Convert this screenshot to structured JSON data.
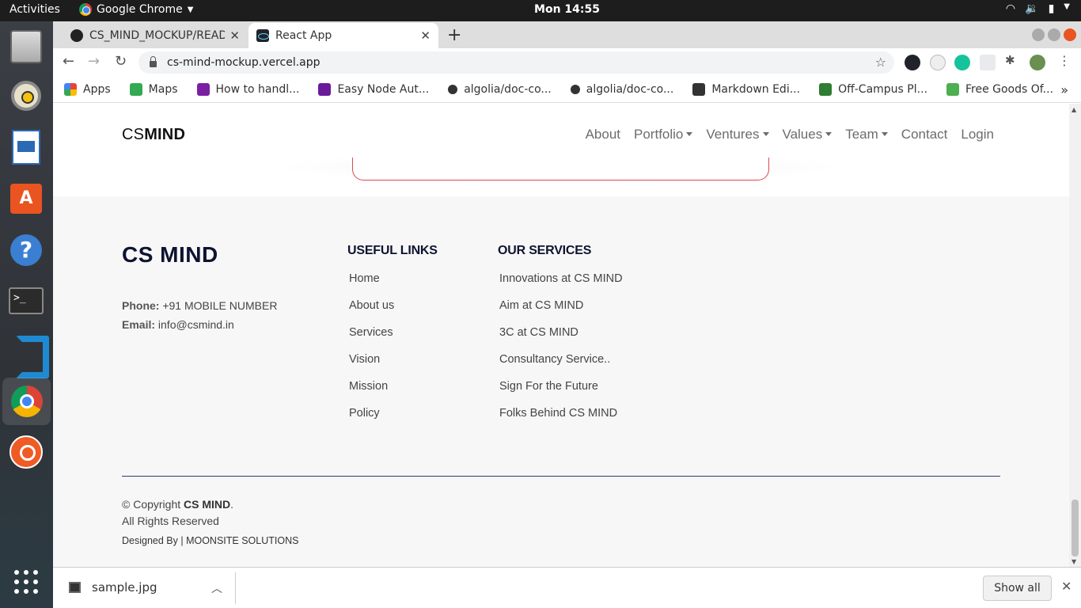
{
  "topbar": {
    "activities": "Activities",
    "app_name": "Google Chrome",
    "clock": "Mon 14:55"
  },
  "tabs": [
    {
      "title": "CS_MIND_MOCKUP/READ",
      "active": false
    },
    {
      "title": "React App",
      "active": true
    }
  ],
  "toolbar": {
    "url": "cs-mind-mockup.vercel.app"
  },
  "bookmarks": [
    {
      "label": "Apps",
      "icon": "apps-grid-icon",
      "color": "#4285f4"
    },
    {
      "label": "Maps",
      "icon": "maps-icon",
      "color": "#34a853"
    },
    {
      "label": "How to handl...",
      "icon": "bookmark-icon",
      "color": "#7b1fa2"
    },
    {
      "label": "Easy Node Aut...",
      "icon": "bookmark-icon",
      "color": "#6a1b9a"
    },
    {
      "label": "algolia/doc-co...",
      "icon": "github-icon",
      "color": "#333333"
    },
    {
      "label": "algolia/doc-co...",
      "icon": "github-icon",
      "color": "#333333"
    },
    {
      "label": "Markdown Edi...",
      "icon": "bookmark-icon",
      "color": "#333333"
    },
    {
      "label": "Off-Campus Pl...",
      "icon": "bookmark-icon",
      "color": "#2e7d32"
    },
    {
      "label": "Free Goods Of...",
      "icon": "tag-icon",
      "color": "#4caf50"
    }
  ],
  "site": {
    "brand_light": "CS",
    "brand_bold": "MIND",
    "nav": [
      {
        "label": "About",
        "dropdown": false
      },
      {
        "label": "Portfolio",
        "dropdown": true
      },
      {
        "label": "Ventures",
        "dropdown": true
      },
      {
        "label": "Values",
        "dropdown": true
      },
      {
        "label": "Team",
        "dropdown": true
      },
      {
        "label": "Contact",
        "dropdown": false
      },
      {
        "label": "Login",
        "dropdown": false
      }
    ]
  },
  "footer": {
    "brand": "CS MIND",
    "phone_label": "Phone:",
    "phone": "+91 MOBILE NUMBER",
    "email_label": "Email:",
    "email": "info@csmind.in",
    "useful_title": "USEFUL LINKS",
    "useful_links": [
      "Home",
      "About us",
      "Services",
      "Vision",
      "Mission",
      "Policy"
    ],
    "services_title": "OUR SERVICES",
    "services": [
      "Innovations at CS MIND",
      "Aim at CS MIND",
      "3C at CS MIND",
      "Consultancy Service..",
      "Sign For the Future",
      "Folks Behind CS MIND"
    ],
    "copyright_prefix": "© Copyright",
    "copyright_name": "CS MIND",
    "copyright_suffix": ".",
    "rights": "All Rights Reserved",
    "designed_by": "Designed By | MOONSITE SOLUTIONS"
  },
  "download": {
    "filename": "sample.jpg",
    "show_all": "Show all"
  },
  "colors": {
    "accent_red": "#e0474c",
    "footer_heading": "#0e1330",
    "chrome_orange": "#e95420"
  }
}
